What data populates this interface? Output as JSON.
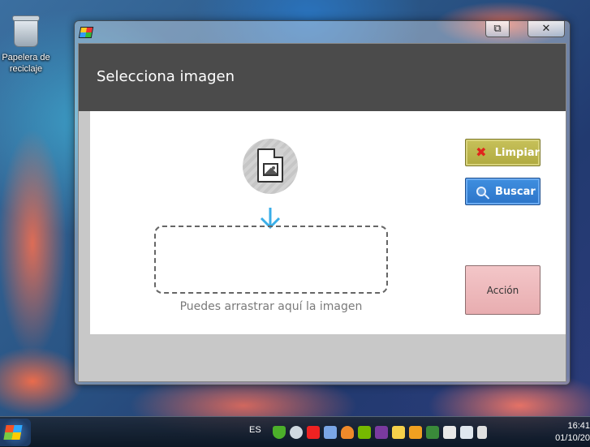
{
  "desktop": {
    "recycle_bin_label": "Papelera de reciclaje"
  },
  "window": {
    "controls": {
      "restore_label": "⧉",
      "close_label": "✕"
    },
    "header": {
      "title": "Selecciona imagen"
    },
    "drop_hint": "Puedes arrastrar aquí la imagen",
    "buttons": {
      "clear_label": "Limpiar",
      "search_label": "Buscar",
      "action_label": "Acción"
    },
    "icons": {
      "file": "image-file-icon",
      "arrow": "arrow-down-icon",
      "clear": "x-icon",
      "search": "magnifier-icon"
    }
  },
  "taskbar": {
    "language": "ES",
    "clock_time": "16:41",
    "clock_date": "01/10/20",
    "tray_icons": [
      "shield-icon",
      "network-icon",
      "antivirus-icon",
      "app-icon",
      "flame-icon",
      "nvidia-icon",
      "notes-icon",
      "mail-icon",
      "outlook-icon",
      "check-icon",
      "flag-icon",
      "screen-icon",
      "speaker-icon"
    ]
  },
  "colors": {
    "header_bg": "#4b4b4b",
    "clear_button": "#c7c15a",
    "search_button": "#3f8fe0",
    "action_button": "#f0bcbf",
    "arrow": "#3aaee8"
  }
}
